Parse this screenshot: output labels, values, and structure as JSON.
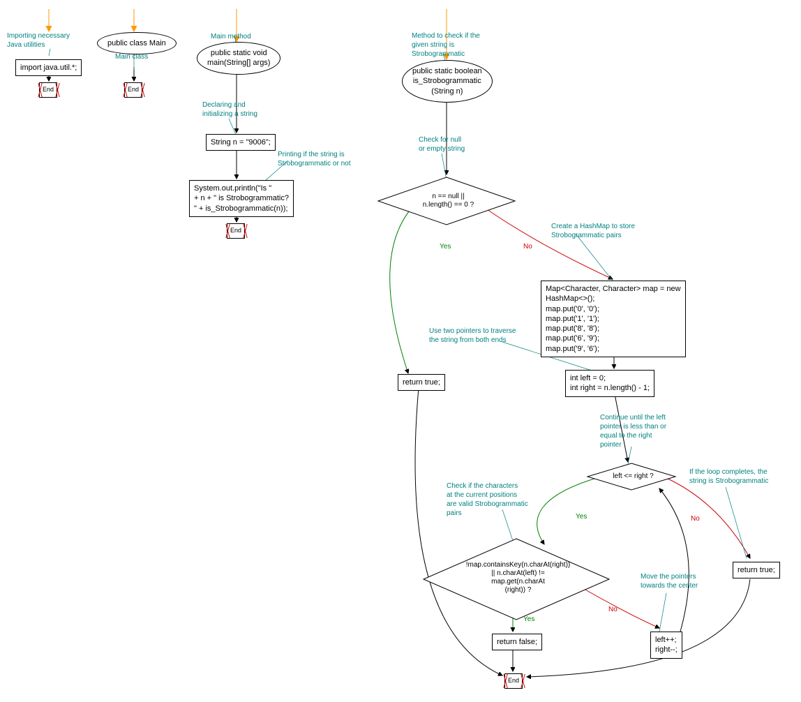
{
  "comments": {
    "import": "Importing necessary\nJava utilities",
    "mainclass": "Main class",
    "mainmethod": "Main method",
    "declaring": "Declaring and\ninitializing a string",
    "printing": "Printing if the string is\nStrobogrammatic or not",
    "method": "Method to check if the\ngiven string is\nStrobogrammatic",
    "checknull": "Check for null\nor empty string",
    "createhash": "Create a HashMap to store\nStrobogrammatic pairs",
    "twopointers": "Use two pointers to traverse\nthe string from both ends",
    "continue": "Continue until the left\npointer is less than or\nequal to the right\npointer",
    "checkchars": "Check if the characters\nat the current positions\nare valid Strobogrammatic\npairs",
    "loopcompletes": "If the loop completes, the\nstring is Strobogrammatic",
    "movepointers": "Move the pointers\ntowards the center"
  },
  "nodes": {
    "import": "import java.util.*;",
    "classMain": "public class Main",
    "publicStaticVoid": "public static void\nmain(String[] args)",
    "stringN": "String n = \"9006\";",
    "println": "System.out.println(\"Is \"\n+ n + \" is Strobogrammatic?\n\" + is_Strobogrammatic(n));",
    "methodSig": "public static boolean\nis_Strobogrammatic\n(String n)",
    "cond1": "n == null ||\nn.length() == 0 ?",
    "returnTrue1": "return true;",
    "hashmap": "Map<Character, Character> map = new\nHashMap<>();\nmap.put('0', '0');\nmap.put('1', '1');\nmap.put('8', '8');\nmap.put('6', '9');\nmap.put('9', '6');",
    "pointers": "int left = 0;\nint right = n.length() - 1;",
    "cond2": "left <= right ?",
    "cond3": "!map.containsKey(n.charAt(right))\n|| n.charAt(left) !=\nmap.get(n.charAt\n(right)) ?",
    "returnFalse": "return false;",
    "returnTrue2": "return true;",
    "increment": "left++;\nright--;"
  },
  "labels": {
    "yes": "Yes",
    "no": "No",
    "end": "End"
  }
}
